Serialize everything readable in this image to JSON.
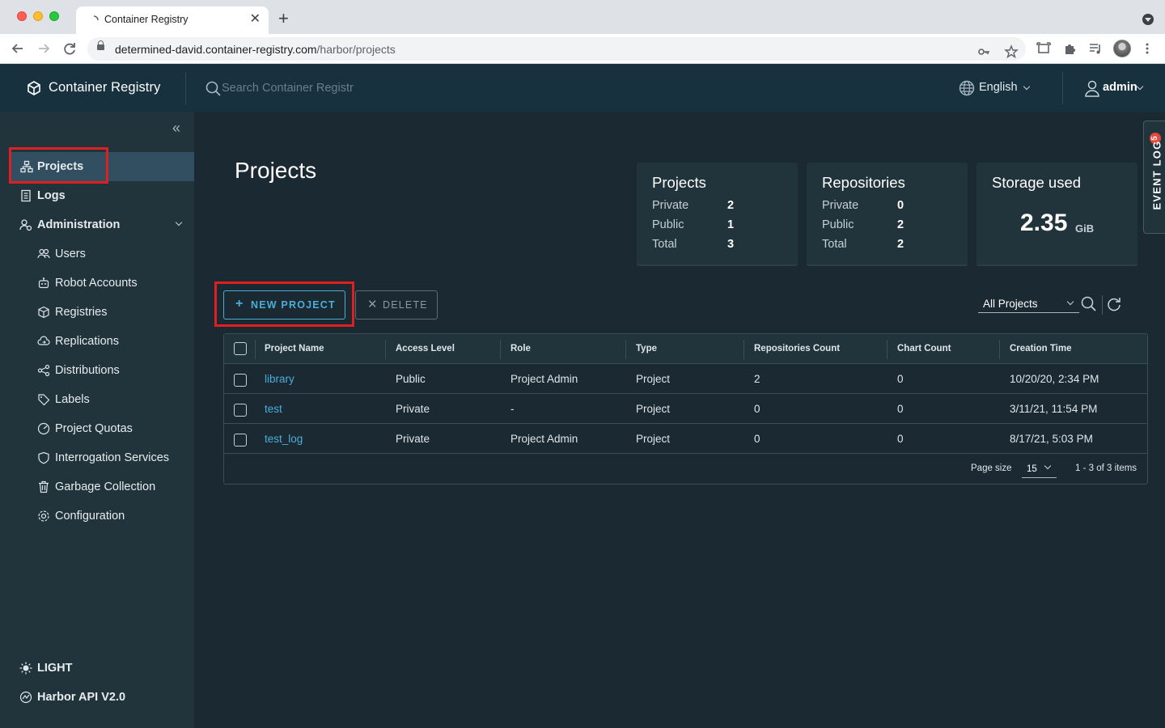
{
  "browser": {
    "tab_title": "Container Registry",
    "url_host": "determined-david.container-registry.com",
    "url_path": "/harbor/projects"
  },
  "header": {
    "brand": "Container Registry",
    "search_placeholder": "Search Container Registr",
    "language": "English",
    "user": "admin"
  },
  "sidebar": {
    "items": [
      {
        "label": "Projects",
        "icon": "projects-icon"
      },
      {
        "label": "Logs",
        "icon": "logs-icon"
      },
      {
        "label": "Administration",
        "icon": "administration-icon"
      },
      {
        "label": "Users",
        "icon": "users-icon"
      },
      {
        "label": "Robot Accounts",
        "icon": "robot-icon"
      },
      {
        "label": "Registries",
        "icon": "registries-icon"
      },
      {
        "label": "Replications",
        "icon": "replications-icon"
      },
      {
        "label": "Distributions",
        "icon": "distributions-icon"
      },
      {
        "label": "Labels",
        "icon": "labels-icon"
      },
      {
        "label": "Project Quotas",
        "icon": "quotas-icon"
      },
      {
        "label": "Interrogation Services",
        "icon": "shield-icon"
      },
      {
        "label": "Garbage Collection",
        "icon": "trash-icon"
      },
      {
        "label": "Configuration",
        "icon": "gear-icon"
      }
    ],
    "footer": {
      "theme": "LIGHT",
      "api": "Harbor API V2.0"
    }
  },
  "main": {
    "title": "Projects",
    "cards": {
      "projects": {
        "title": "Projects",
        "rows": [
          {
            "label": "Private",
            "value": "2"
          },
          {
            "label": "Public",
            "value": "1"
          },
          {
            "label": "Total",
            "value": "3"
          }
        ]
      },
      "repositories": {
        "title": "Repositories",
        "rows": [
          {
            "label": "Private",
            "value": "0"
          },
          {
            "label": "Public",
            "value": "2"
          },
          {
            "label": "Total",
            "value": "2"
          }
        ]
      },
      "storage": {
        "title": "Storage used",
        "value": "2.35",
        "unit": "GiB"
      }
    },
    "actions": {
      "new_project": "NEW PROJECT",
      "delete": "DELETE"
    },
    "filter": "All Projects",
    "table": {
      "columns": [
        "Project Name",
        "Access Level",
        "Role",
        "Type",
        "Repositories Count",
        "Chart Count",
        "Creation Time"
      ],
      "rows": [
        {
          "name": "library",
          "access": "Public",
          "role": "Project Admin",
          "type": "Project",
          "repos": "2",
          "charts": "0",
          "created": "10/20/20, 2:34 PM"
        },
        {
          "name": "test",
          "access": "Private",
          "role": "-",
          "type": "Project",
          "repos": "0",
          "charts": "0",
          "created": "3/11/21, 11:54 PM"
        },
        {
          "name": "test_log",
          "access": "Private",
          "role": "Project Admin",
          "type": "Project",
          "repos": "0",
          "charts": "0",
          "created": "8/17/21, 5:03 PM"
        }
      ],
      "page_size_label": "Page size",
      "page_size": "15",
      "count": "1 - 3 of 3 items"
    },
    "event_log": {
      "label": "EVENT LOG",
      "badge": "5"
    }
  },
  "colors": {
    "accent": "#4aaed9",
    "highlight": "#e01f20",
    "header_bg": "#17313f",
    "sidebar_bg": "#21333b",
    "main_bg": "#1b2a32"
  }
}
